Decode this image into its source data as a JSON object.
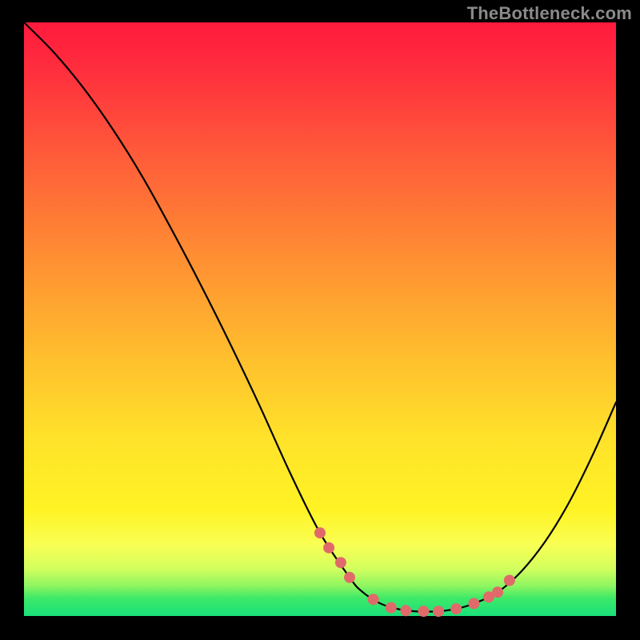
{
  "watermark": "TheBottleneck.com",
  "chart_data": {
    "type": "line",
    "title": "",
    "xlabel": "",
    "ylabel": "",
    "xlim": [
      0,
      100
    ],
    "ylim": [
      0,
      100
    ],
    "curve": {
      "name": "bottleneck-curve",
      "x": [
        0,
        5,
        10,
        15,
        20,
        25,
        30,
        35,
        40,
        45,
        50,
        55,
        57,
        60,
        63,
        66,
        70,
        73,
        76,
        80,
        84,
        88,
        92,
        96,
        100
      ],
      "y": [
        100,
        95,
        89,
        82,
        74,
        65,
        55.5,
        45.5,
        35,
        24,
        14,
        6.5,
        4.2,
        2.2,
        1.2,
        0.8,
        0.8,
        1.2,
        2.1,
        4.0,
        7.5,
        12.5,
        19,
        27,
        36
      ]
    },
    "markers": {
      "name": "highlighted-points",
      "color": "#e06a6a",
      "radius_px": 7,
      "x": [
        50,
        51.5,
        53.5,
        55,
        59,
        62,
        64.5,
        67.5,
        70,
        73,
        76,
        78.5,
        80,
        82
      ],
      "y": [
        14,
        11.5,
        9,
        6.5,
        2.8,
        1.4,
        0.9,
        0.8,
        0.8,
        1.2,
        2.1,
        3.2,
        4.0,
        6.0
      ]
    },
    "gradient_stops": [
      {
        "pos": 0.0,
        "color": "#ff1a3d"
      },
      {
        "pos": 0.55,
        "color": "#ffbb2e"
      },
      {
        "pos": 0.82,
        "color": "#fff324"
      },
      {
        "pos": 0.95,
        "color": "#8cf561"
      },
      {
        "pos": 1.0,
        "color": "#19e07a"
      }
    ]
  }
}
